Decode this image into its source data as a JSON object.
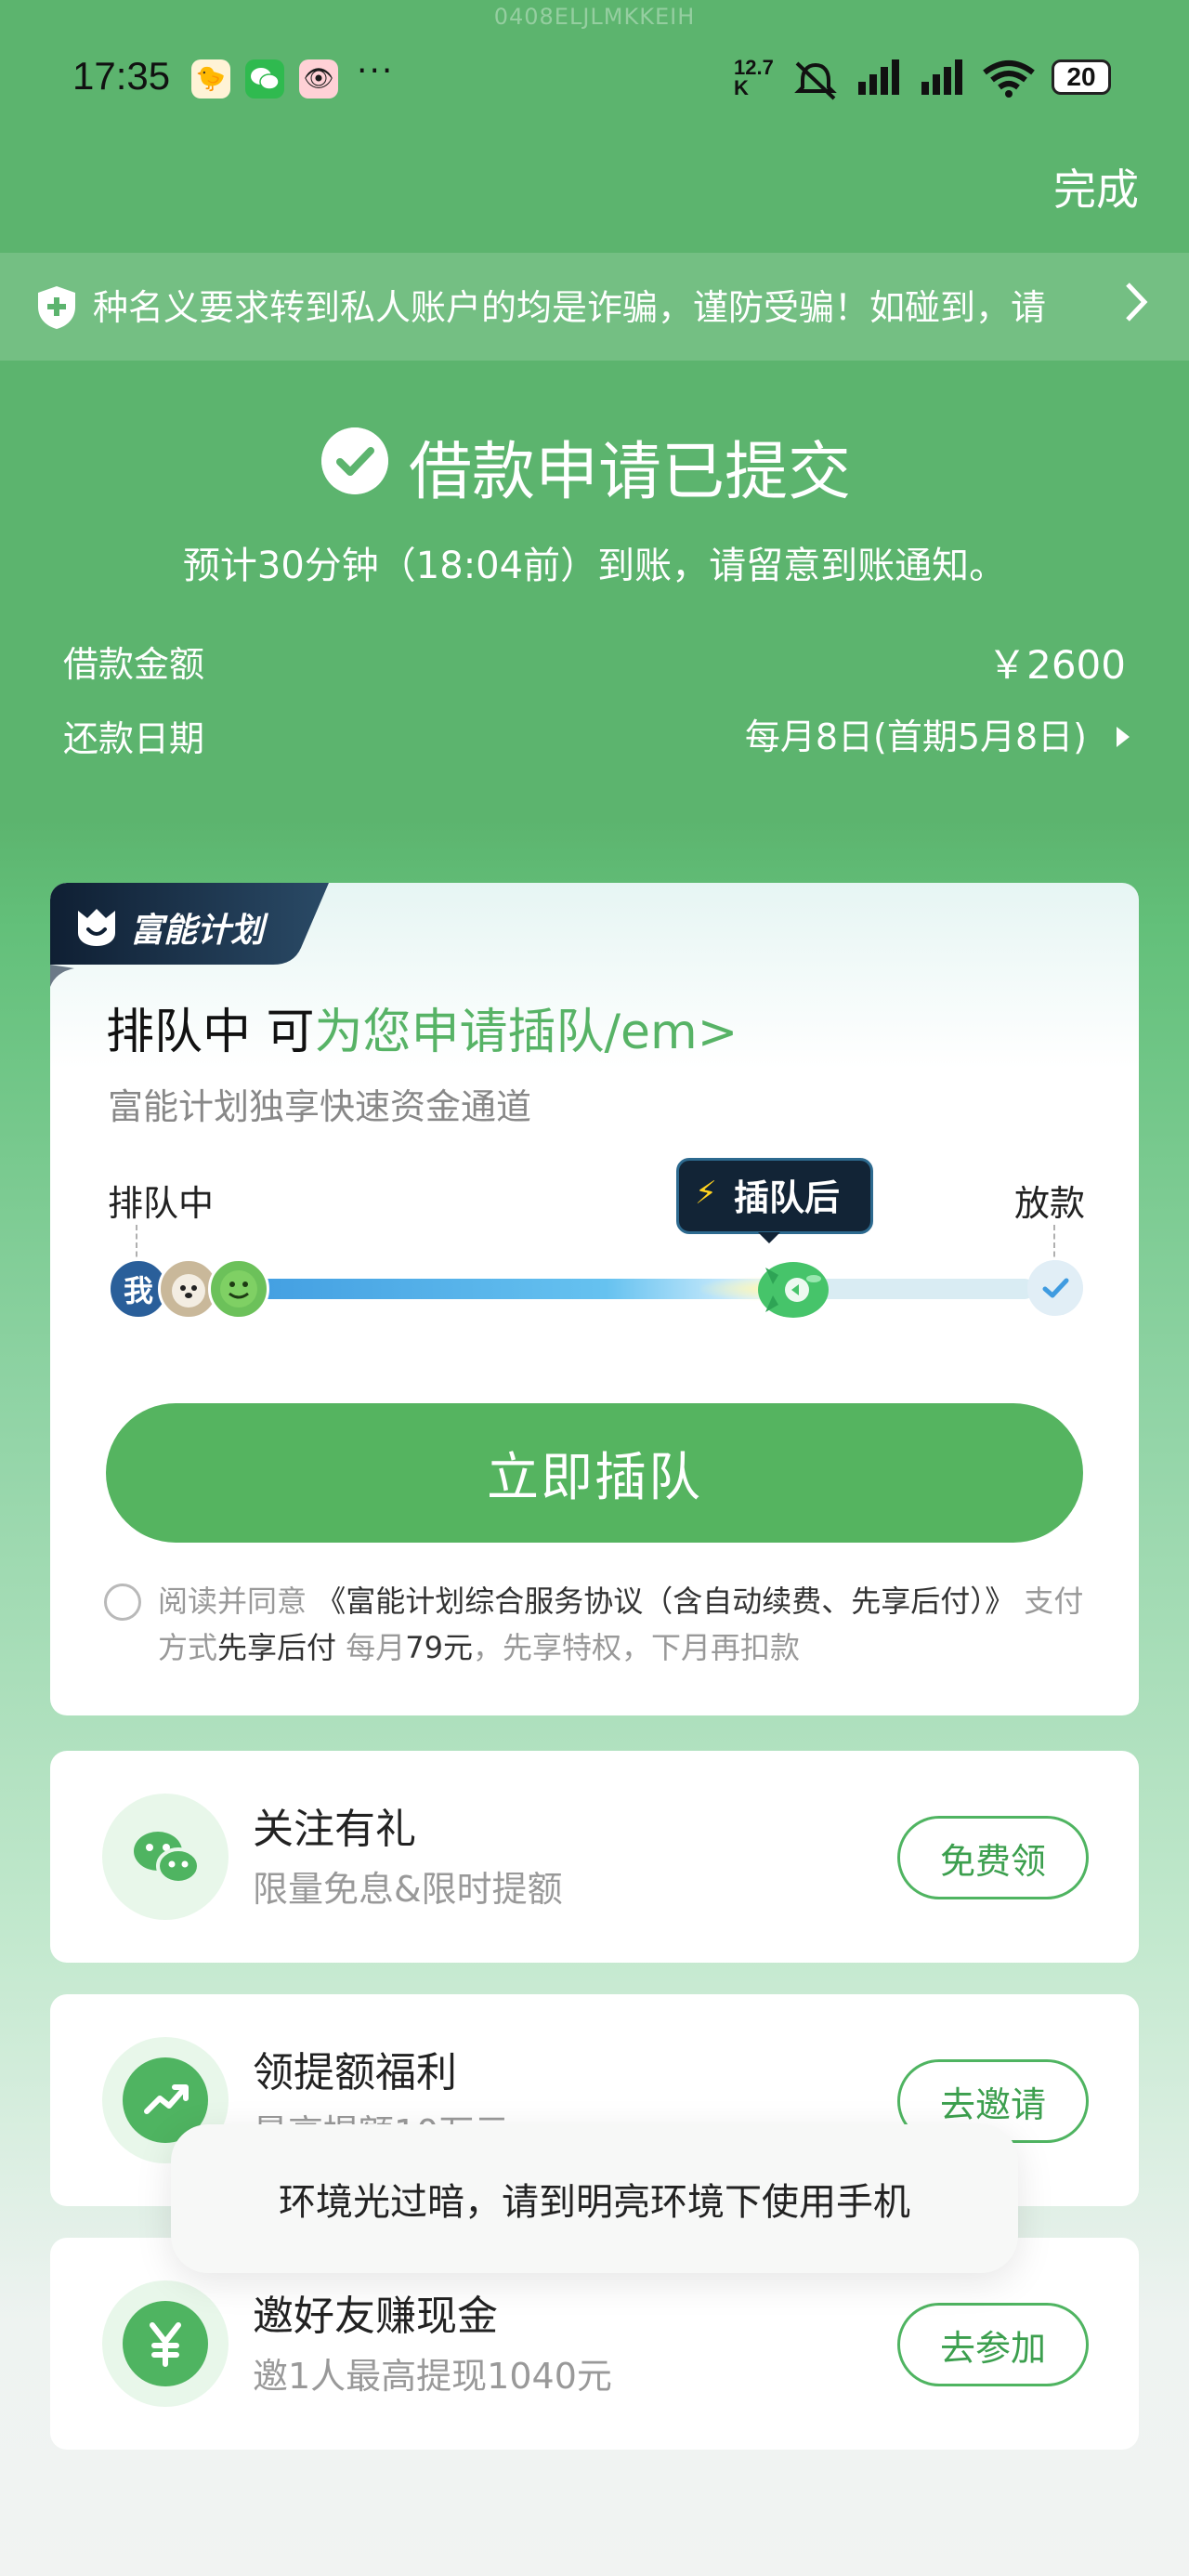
{
  "watermark": "0408ELJLMKKEIH",
  "status_bar": {
    "time": "17:35",
    "apps": [
      "duck-app-icon",
      "wechat-icon",
      "weibo-icon"
    ],
    "more": "···",
    "speed_value": "12.7",
    "speed_unit": "K",
    "battery": "20"
  },
  "header": {
    "done_label": "完成"
  },
  "notice": {
    "text": "种名义要求转到私人账户的均是诈骗，谨防受骗！如碰到，请"
  },
  "result": {
    "title": "借款申请已提交",
    "eta": "预计30分钟（18:04前）到账，请留意到账通知。",
    "amount_label": "借款金额",
    "amount_value": "￥2600",
    "repay_label": "还款日期",
    "repay_value": "每月8日(首期5月8日)"
  },
  "plan_card": {
    "tag": "富能计划",
    "title_prefix": "排队中 可",
    "title_highlight": "为您申请插队/em>",
    "subtitle": "富能计划独享快速资金通道",
    "progress_start_label": "排队中",
    "progress_bubble_label": "插队后",
    "progress_end_label": "放款",
    "progress_fraction": 0.68,
    "avatar_me": "我",
    "cta_label": "立即插队",
    "agree_prefix": "阅读并同意",
    "agree_doc": "《富能计划综合服务协议（含自动续费、先享后付）》",
    "agree_pay_label": "支付方式",
    "agree_pay_value": "先享后付",
    "agree_price_prefix": "每月",
    "agree_price": "79元",
    "agree_suffix": "，先享特权，下月再扣款"
  },
  "tasks": [
    {
      "title": "关注有礼",
      "subtitle": "限量免息&限时提额",
      "button": "免费领",
      "icon": "wechat-icon"
    },
    {
      "title": "领提额福利",
      "subtitle": "最高提额10万元",
      "button": "去邀请",
      "icon": "trend-up-icon"
    },
    {
      "title": "邀好友赚现金",
      "subtitle": "邀1人最高提现1040元",
      "button": "去参加",
      "icon": "yuan-icon"
    }
  ],
  "toast": "环境光过暗，请到明亮环境下使用手机",
  "colors": {
    "brand_green": "#55b460",
    "header_green": "#5cb46e",
    "accent_text_green": "#57b366",
    "progress_blue": "#3f9be0"
  }
}
